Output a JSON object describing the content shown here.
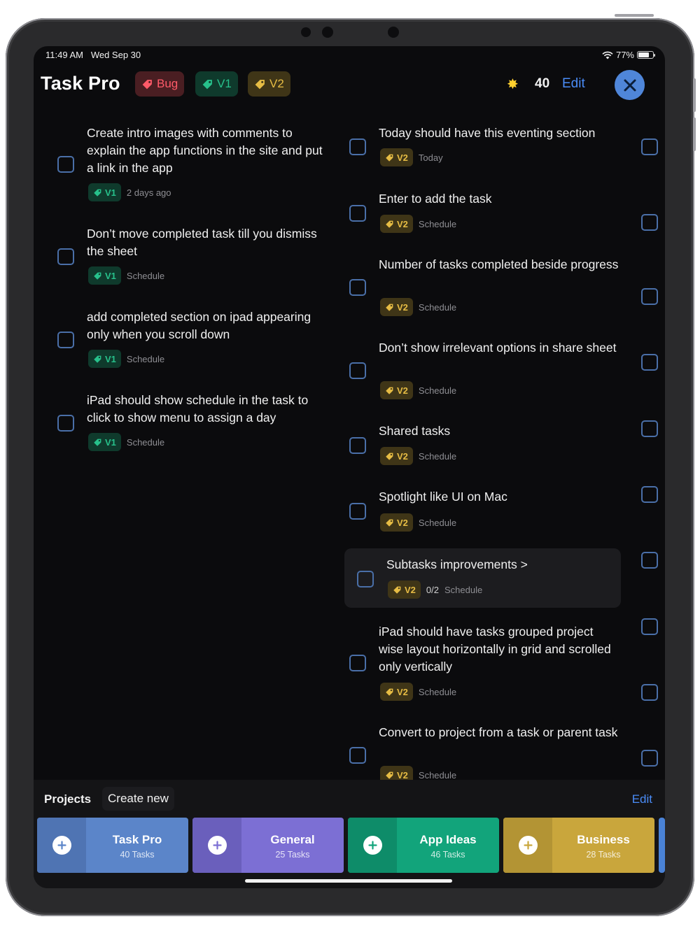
{
  "status_bar": {
    "time": "11:49 AM",
    "date": "Wed Sep 30",
    "battery": "77%",
    "battery_level": 0.77
  },
  "header": {
    "title": "Task Pro",
    "tags": [
      {
        "label": "Bug",
        "color": "#ff5a69"
      },
      {
        "label": "V1",
        "color": "#27c18b"
      },
      {
        "label": "V2",
        "color": "#e6bc44"
      }
    ],
    "score": "40",
    "edit_label": "Edit",
    "icons": {
      "star": "star-icon",
      "close": "close-icon"
    }
  },
  "columns": {
    "left": [
      {
        "text": "Create intro images with comments to explain the app functions in the site and put a link in the app",
        "tag": "V1",
        "meta": "2 days ago"
      },
      {
        "text": "Don’t move completed task till you dismiss the sheet",
        "tag": "V1",
        "meta": "Schedule"
      },
      {
        "text": "add completed section on ipad appearing only when you scroll down",
        "tag": "V1",
        "meta": "Schedule"
      },
      {
        "text": "iPad should show schedule in the task to click to show menu to assign a day",
        "tag": "V1",
        "meta": "Schedule"
      }
    ],
    "middle": [
      {
        "text": "Today should have this eventing section",
        "tag": "V2",
        "meta": "Today"
      },
      {
        "text": "Enter to add the task",
        "tag": "V2",
        "meta": "Schedule"
      },
      {
        "text": "Number of tasks completed beside progress",
        "tag": "V2",
        "meta": "Schedule"
      },
      {
        "text": "Don’t show irrelevant options in share sheet",
        "tag": "V2",
        "meta": "Schedule"
      },
      {
        "text": "Shared tasks",
        "tag": "V2",
        "meta": "Schedule"
      },
      {
        "text": "Spotlight like UI on Mac",
        "tag": "V2",
        "meta": "Schedule"
      },
      {
        "text": "Subtasks improvements  >",
        "tag": "V2",
        "count": "0/2",
        "meta": "Schedule",
        "selected": true
      },
      {
        "text": "iPad should have tasks grouped project wise layout horizontally in grid and scrolled only vertically",
        "tag": "V2",
        "meta": "Schedule"
      },
      {
        "text": "Convert to project from a task or parent task",
        "tag": "V2",
        "meta": "Schedule"
      }
    ]
  },
  "projects": {
    "label": "Projects",
    "create_new": "Create new",
    "edit_label": "Edit",
    "items": [
      {
        "name": "Task Pro",
        "count": "40 Tasks",
        "color": "#5b85c9",
        "plus_color": "#4f74b3"
      },
      {
        "name": "General",
        "count": "25 Tasks",
        "color": "#7c6fd4",
        "plus_color": "#6a5fbc"
      },
      {
        "name": "App Ideas",
        "count": "46 Tasks",
        "color": "#12a47b",
        "plus_color": "#0e8c69"
      },
      {
        "name": "Business",
        "count": "28 Tasks",
        "color": "#c9a63c",
        "plus_color": "#b39434"
      }
    ]
  }
}
